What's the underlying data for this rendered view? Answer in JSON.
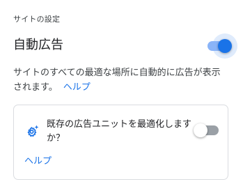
{
  "section_label": "サイトの設定",
  "setting": {
    "title": "自動広告",
    "enabled": true,
    "description": "サイトのすべての最適な場所に自動的に広告が表示されます。",
    "help_link": "ヘルプ"
  },
  "optimize_card": {
    "icon": "gear-sparkle-icon",
    "question": "既存の広告ユニットを最適化しますか？",
    "enabled": false,
    "help_link": "ヘルプ"
  },
  "colors": {
    "accent": "#1a73e8",
    "track_on": "#8ab4f8",
    "track_off": "#9aa0a6",
    "card_border": "#dadce0"
  }
}
